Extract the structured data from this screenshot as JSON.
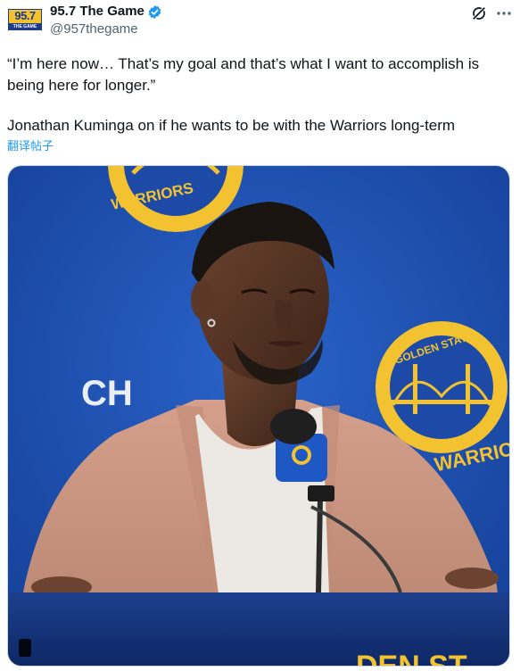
{
  "account": {
    "display_name": "95.7 The Game",
    "handle": "@957thegame",
    "logo_text_top": "95.7",
    "logo_text_bottom": "THE GAME"
  },
  "tweet": {
    "quote_line1": "“I’m here now… That’s my goal and that’s what I want to accomplish is",
    "quote_line2": "being here for longer.”",
    "caption": "Jonathan Kuminga on if he wants to be with the Warriors long-term",
    "translate_label": "翻译帖子"
  },
  "media": {
    "backdrop_text": [
      "WARRIORS",
      "GOLDEN STATE",
      "WARRIORS",
      "CH",
      "DEN ST"
    ]
  },
  "icons": {
    "verified": "verified-badge-icon",
    "grok": "grok-icon",
    "more": "more-options-icon"
  },
  "colors": {
    "accent": "#1d9bf0",
    "backdrop_blue": "#1b4fb3",
    "warriors_gold": "#f2c230"
  }
}
